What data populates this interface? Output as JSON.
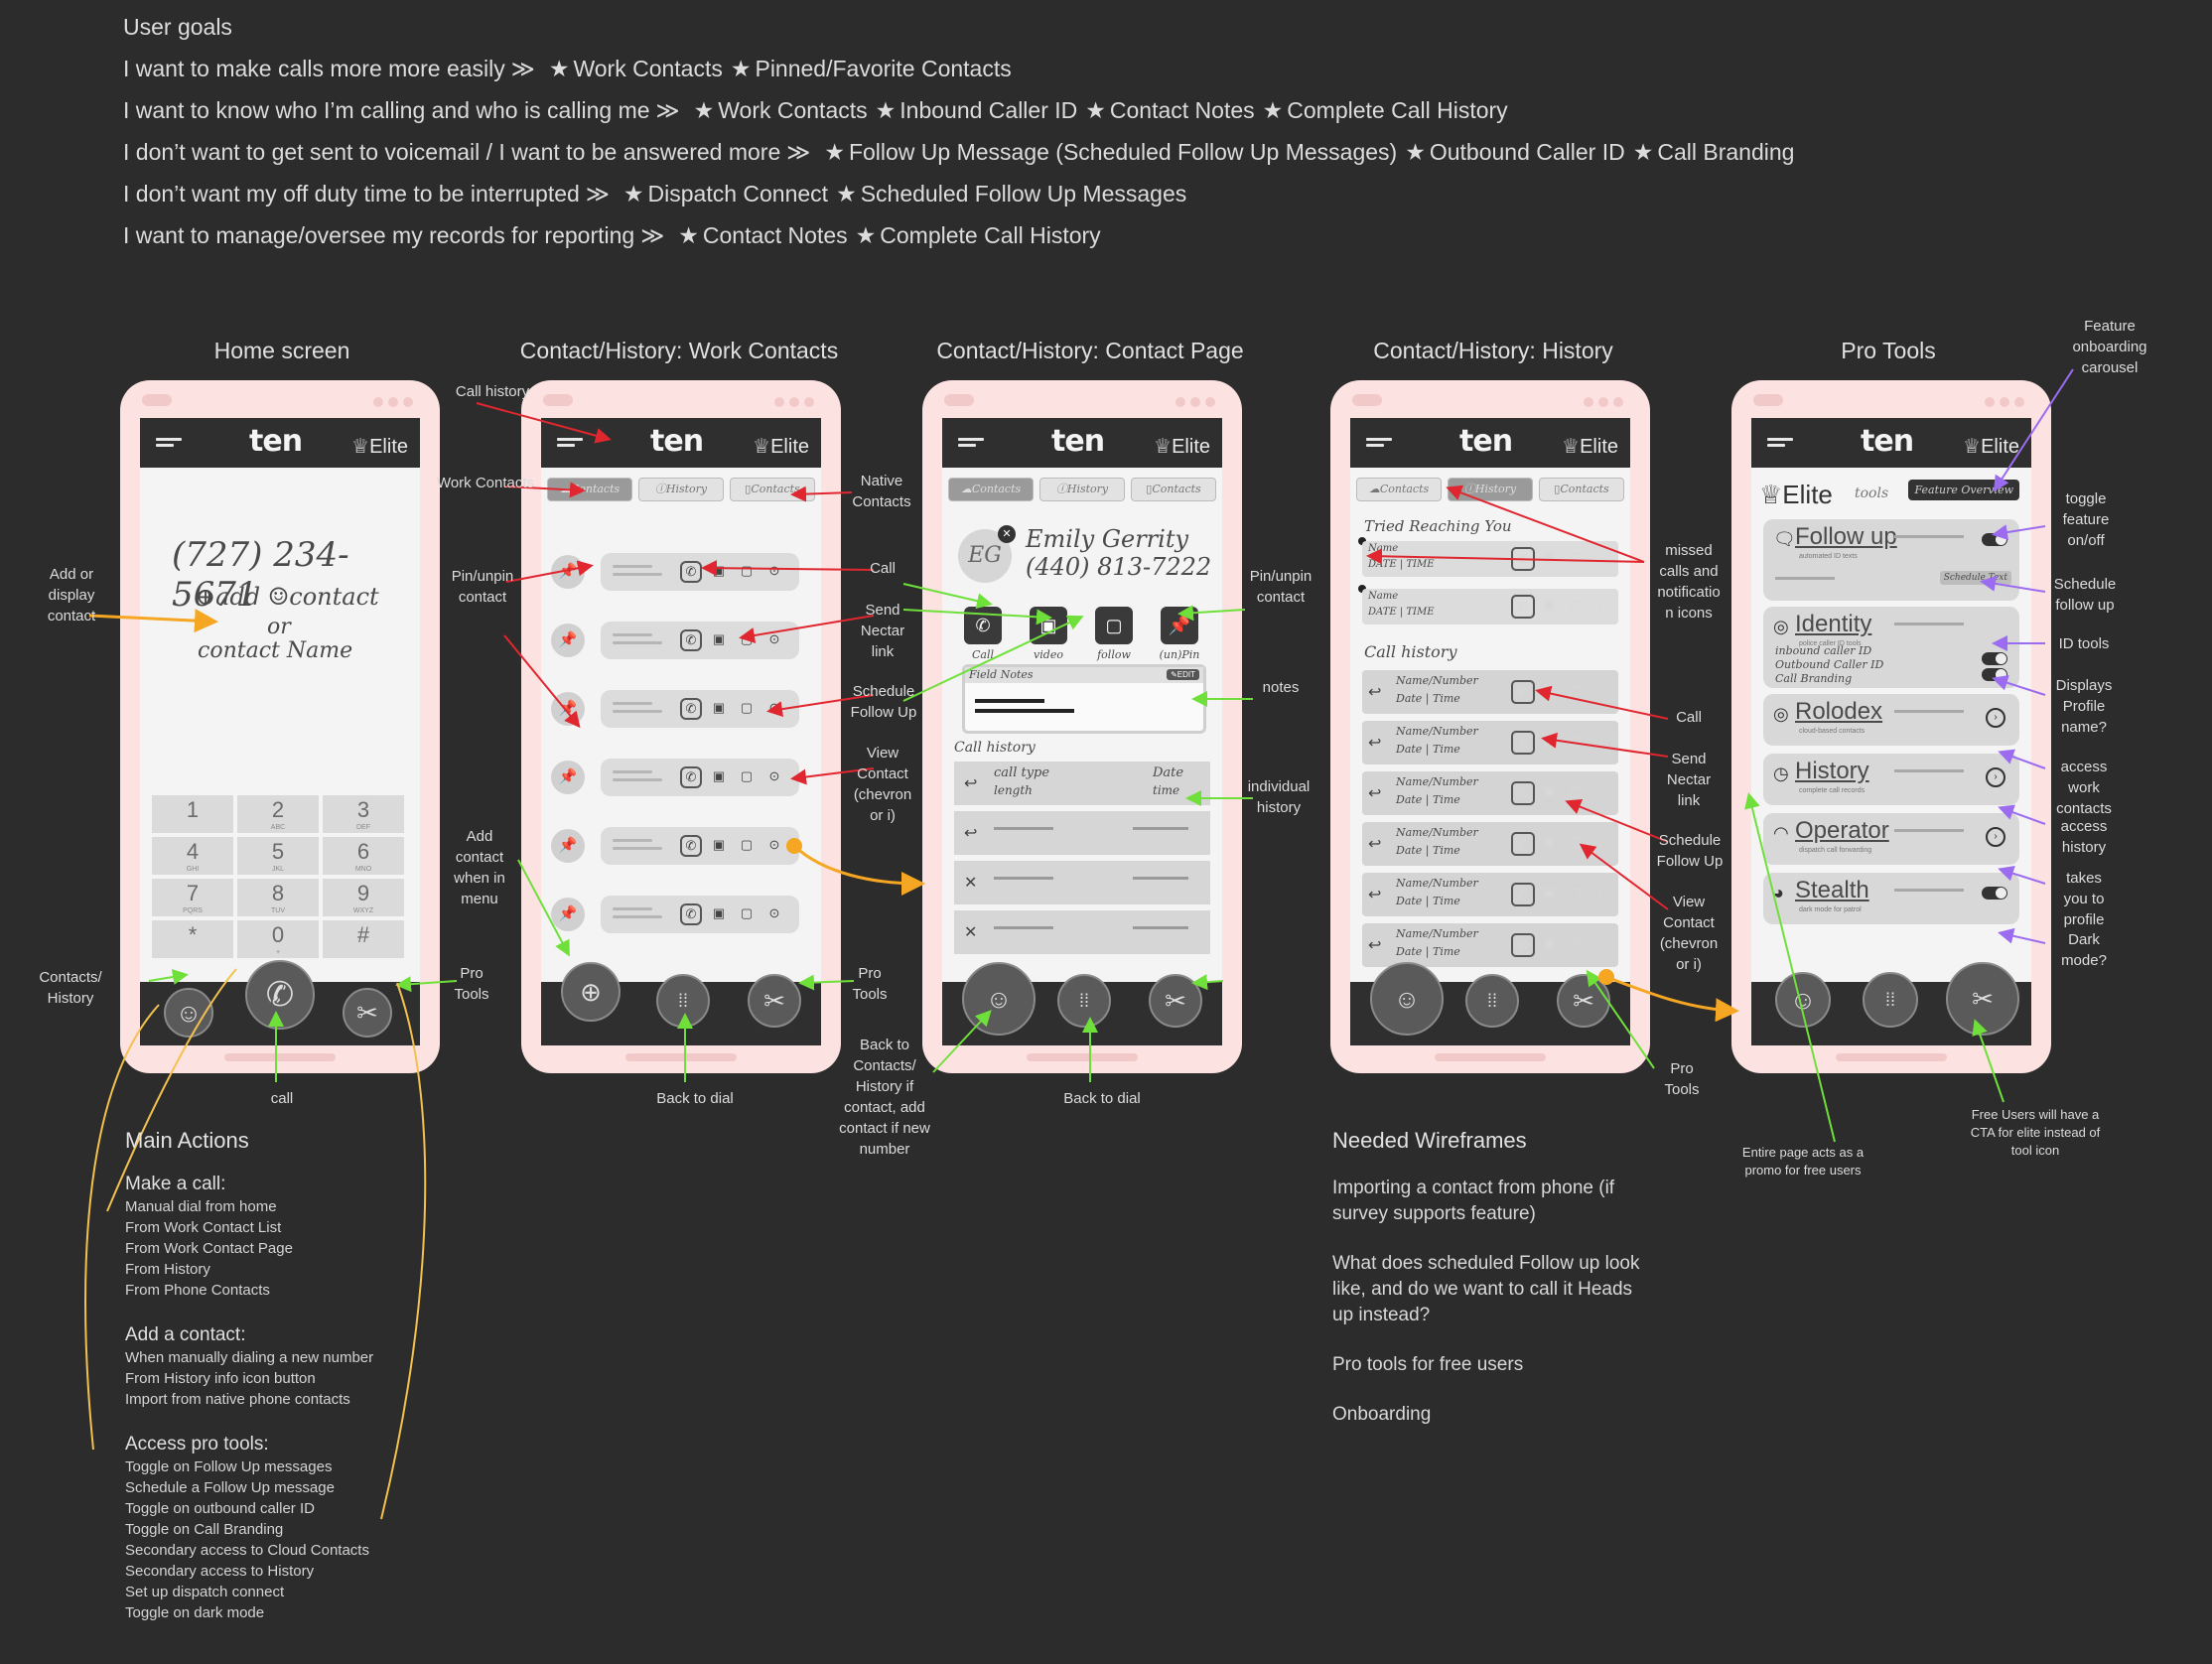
{
  "user_goals": {
    "heading": "User goals",
    "lines": [
      {
        "goal": "I want to make calls more more easily",
        "features": [
          "Work Contacts",
          "Pinned/Favorite Contacts"
        ]
      },
      {
        "goal": "I want to know who I’m calling and who is calling me",
        "features": [
          "Work Contacts",
          "Inbound Caller ID",
          "Contact Notes",
          "Complete Call History"
        ]
      },
      {
        "goal": "I don’t want to get sent to voicemail / I want to be answered more",
        "features": [
          "Follow Up Message (Scheduled Follow Up Messages)",
          "Outbound Caller ID",
          "Call Branding"
        ]
      },
      {
        "goal": "I don’t want my off duty time to be interrupted",
        "features": [
          "Dispatch Connect",
          "Scheduled Follow Up Messages"
        ]
      },
      {
        "goal": "I want to manage/oversee my records for reporting",
        "features": [
          "Contact Notes",
          "Complete Call History"
        ]
      }
    ]
  },
  "screens": {
    "home": {
      "title": "Home screen"
    },
    "work_contacts": {
      "title": "Contact/History: Work Contacts"
    },
    "contact_page": {
      "title": "Contact/History: Contact Page"
    },
    "history": {
      "title": "Contact/History: History"
    },
    "pro_tools": {
      "title": "Pro Tools"
    }
  },
  "app": {
    "logo": "ten",
    "elite": "♕Elite"
  },
  "tabs": {
    "contacts": "☁Contacts",
    "history": "ⓘHistory",
    "native": "▯Contacts"
  },
  "home_screen": {
    "number": "(727) 234-5671",
    "add_contact": "⊕add ☺contact",
    "or": "or",
    "contact_name": "contact Name",
    "keys": [
      {
        "d": "1",
        "l": ""
      },
      {
        "d": "2",
        "l": "ABC"
      },
      {
        "d": "3",
        "l": "DEF"
      },
      {
        "d": "4",
        "l": "GHI"
      },
      {
        "d": "5",
        "l": "JKL"
      },
      {
        "d": "6",
        "l": "MNO"
      },
      {
        "d": "7",
        "l": "PQRS"
      },
      {
        "d": "8",
        "l": "TUV"
      },
      {
        "d": "9",
        "l": "WXYZ"
      },
      {
        "d": "*",
        "l": ""
      },
      {
        "d": "0",
        "l": "+"
      },
      {
        "d": "#",
        "l": ""
      }
    ]
  },
  "contact_page": {
    "initials": "EG",
    "name": "Emily Gerrity",
    "phone": "(440) 813-7222",
    "actions": [
      "Call",
      "video",
      "follow up",
      "(un)Pin"
    ],
    "notes_label": "Field Notes",
    "edit_label": "✎EDIT",
    "call_history_label": "Call history",
    "call_type": "call type",
    "length": "length",
    "date": "Date",
    "time": "time"
  },
  "history_screen": {
    "tried": "Tried Reaching You",
    "name": "Name",
    "date_time": "DATE | TIME",
    "call_history": "Call history",
    "row_name": "Name/Number",
    "row_date": "Date | Time"
  },
  "pro_tools_screen": {
    "header": "♕Elite",
    "tools_word": "tools",
    "carousel": "Feature Overview",
    "schedule_text": "Schedule Text",
    "identity_items": [
      "police caller ID tools",
      "inbound caller ID",
      "Outbound Caller ID",
      "Call Branding"
    ],
    "tools": [
      {
        "name": "Follow up",
        "sub": "automated ID texts",
        "icon": "🗨"
      },
      {
        "name": "Identity",
        "sub": "police caller ID tools",
        "icon": "◎"
      },
      {
        "name": "Rolodex",
        "sub": "cloud-based contacts",
        "icon": "◎"
      },
      {
        "name": "History",
        "sub": "complete call records",
        "icon": "◷"
      },
      {
        "name": "Operator",
        "sub": "dispatch call forwarding",
        "icon": "◠"
      },
      {
        "name": "Stealth",
        "sub": "dark mode for patrol",
        "icon": "◕"
      }
    ]
  },
  "annotations": {
    "add_or_display": "Add or\ndisplay\ncontact",
    "contacts_history": "Contacts/\nHistory",
    "pro_tools": "Pro\nTools",
    "call": "call",
    "call_history": "Call history",
    "work_contacts": "Work Contacts",
    "native_contacts": "Native\nContacts",
    "pin_unpin": "Pin/unpin\ncontact",
    "call_short": "Call",
    "send_nectar": "Send\nNectar\nlink",
    "schedule_follow": "Schedule\nFollow Up",
    "view_contact": "View\nContact\n(chevron\nor i)",
    "add_contact_menu": "Add\ncontact\nwhen in\nmenu",
    "back_to_dial": "Back to dial",
    "back_to_contacts": "Back to\nContacts/\nHistory if\ncontact, add\ncontact if new\nnumber",
    "notes": "notes",
    "individual_history": "individual\nhistory",
    "missed_calls": "missed\ncalls and\nnotificatio\nn icons",
    "feature_onboarding": "Feature\nonboarding\ncarousel",
    "toggle_feature": "toggle\nfeature\non/off",
    "schedule_follow_lower": "Schedule\nfollow up",
    "id_tools": "ID tools",
    "displays_profile": "Displays\nProfile\nname?",
    "access_work": "access\nwork\ncontacts",
    "access_history": "access\nhistory",
    "takes_profile": "takes\nyou to\nprofile",
    "dark_mode": "Dark\nmode?",
    "entire_page": "Entire page acts as a\npromo for free users",
    "free_users_cta": "Free Users will have a\nCTA for elite instead of\ntool icon"
  },
  "main_actions": {
    "title": "Main Actions",
    "groups": [
      {
        "heading": "Make a call:",
        "items": [
          "Manual dial from home",
          "From Work Contact List",
          "From Work Contact Page",
          "From History",
          "From Phone Contacts"
        ]
      },
      {
        "heading": "Add a contact:",
        "items": [
          "When manually dialing a new number",
          "From History info icon button",
          "Import from native phone contacts"
        ]
      },
      {
        "heading": "Access pro tools:",
        "items": [
          "Toggle on Follow Up messages",
          "Schedule a Follow Up message",
          "Toggle on outbound caller ID",
          "Toggle on Call Branding",
          "Secondary access to Cloud Contacts",
          "Secondary access to History",
          "Set up dispatch connect",
          "Toggle on dark mode"
        ]
      }
    ]
  },
  "needed_wireframes": {
    "title": "Needed Wireframes",
    "items": [
      "Importing a contact from phone (if survey supports feature)",
      "What does scheduled Follow up look like, and do we want to call it Heads up instead?",
      "Pro tools for free users",
      "Onboarding"
    ]
  },
  "colors": {
    "arrow_red": "#e0262f",
    "arrow_green": "#6fe03a",
    "arrow_orange": "#f5a623",
    "arrow_yellow": "#f2c14e",
    "arrow_purple": "#9b6cf0"
  }
}
